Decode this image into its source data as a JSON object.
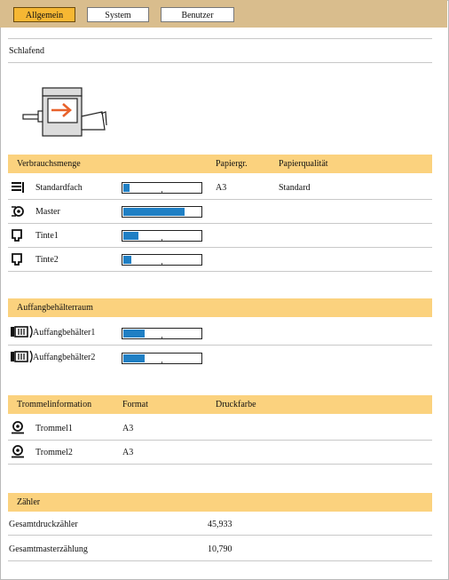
{
  "tabs": [
    {
      "label": "Allgemein",
      "active": true
    },
    {
      "label": "System",
      "active": false
    },
    {
      "label": "Benutzer",
      "active": false
    }
  ],
  "status": {
    "text": "Schlafend"
  },
  "consumables": {
    "headers": {
      "name": "Verbrauchsmenge",
      "paper_size": "Papiergr.",
      "paper_quality": "Papierqualität"
    },
    "rows": [
      {
        "icon": "paper-tray-icon",
        "label": "Standardfach",
        "level_percent": 8,
        "paper_size": "A3",
        "paper_quality": "Standard"
      },
      {
        "icon": "master-roll-icon",
        "label": "Master",
        "level_percent": 79,
        "paper_size": "",
        "paper_quality": ""
      },
      {
        "icon": "ink-cartridge-icon",
        "label": "Tinte1",
        "level_percent": 20,
        "paper_size": "",
        "paper_quality": ""
      },
      {
        "icon": "ink-cartridge-icon",
        "label": "Tinte2",
        "level_percent": 10,
        "paper_size": "",
        "paper_quality": ""
      }
    ]
  },
  "disposal": {
    "header": "Auffangbehälterraum",
    "rows": [
      {
        "icon": "disposal-box-icon",
        "label": "Auffangbehälter1",
        "level_percent": 28
      },
      {
        "icon": "disposal-box-icon",
        "label": "Auffangbehälter2",
        "level_percent": 28
      }
    ]
  },
  "drums": {
    "headers": {
      "name": "Trommelinformation",
      "format": "Format",
      "ink": "Druckfarbe"
    },
    "rows": [
      {
        "icon": "drum-icon",
        "label": "Trommel1",
        "format": "A3",
        "ink": ""
      },
      {
        "icon": "drum-icon",
        "label": "Trommel2",
        "format": "A3",
        "ink": ""
      }
    ]
  },
  "counters": {
    "header": "Zähler",
    "rows": [
      {
        "label": "Gesamtdruckzähler",
        "value": "45,933"
      },
      {
        "label": "Gesamtmasterzählung",
        "value": "10,790"
      }
    ]
  },
  "colors": {
    "accent_tab": "#f6b733",
    "section_header": "#fbd27e",
    "tabbar": "#d9bd8d",
    "level_fill": "#1f7fc4",
    "arrow": "#e8622b"
  }
}
